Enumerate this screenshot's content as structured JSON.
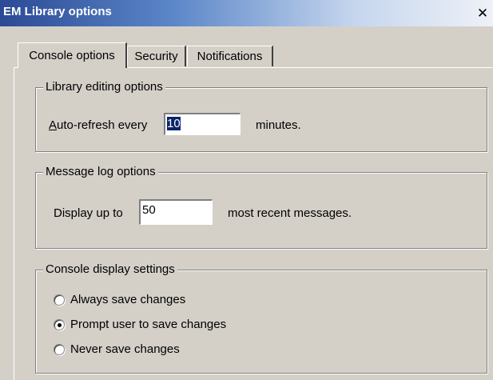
{
  "window": {
    "title": "EM Library options",
    "close_glyph": "✕"
  },
  "tabs": [
    {
      "label": "Console options",
      "selected": true
    },
    {
      "label": "Security",
      "selected": false
    },
    {
      "label": "Notifications",
      "selected": false
    }
  ],
  "library_editing": {
    "group_label": "Library editing options",
    "prefix_label": "Auto-refresh every",
    "value": "10",
    "suffix_label": "minutes."
  },
  "message_log": {
    "group_label": "Message log options",
    "prefix_label": "Display up to",
    "value": "50",
    "suffix_label": "most recent messages."
  },
  "console_display": {
    "group_label": "Console display settings",
    "options": [
      {
        "label": "Always save changes",
        "checked": false
      },
      {
        "label": "Prompt user to save changes",
        "checked": true
      },
      {
        "label": "Never save changes",
        "checked": false
      }
    ]
  },
  "colors": {
    "dialog_bg": "#d4d0c8",
    "title_start": "#2b4a95",
    "title_end": "#eef1f7",
    "selection": "#0a246a"
  }
}
